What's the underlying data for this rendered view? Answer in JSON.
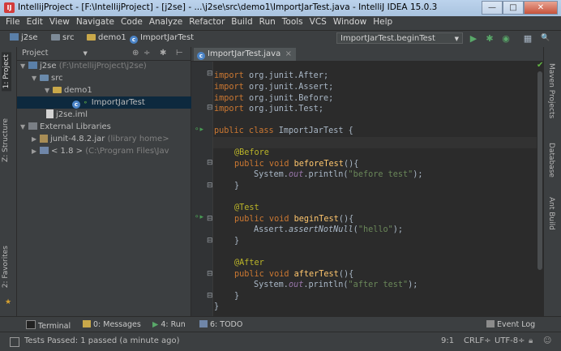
{
  "window": {
    "title": "IntellijProject - [F:\\IntellijProject] - [j2se] - ...\\j2se\\src\\demo1\\ImportJarTest.java - IntelliJ IDEA 15.0.3",
    "min": "—",
    "max": "□",
    "close": "✕"
  },
  "menu": [
    "File",
    "Edit",
    "View",
    "Navigate",
    "Code",
    "Analyze",
    "Refactor",
    "Build",
    "Run",
    "Tools",
    "VCS",
    "Window",
    "Help"
  ],
  "breadcrumb": {
    "project": "j2se",
    "src": "src",
    "pkg": "demo1",
    "file": "ImportJarTest"
  },
  "run_config": {
    "label": "ImportJarTest.beginTest",
    "caret": "▼"
  },
  "toolbar": {
    "run": "▶",
    "debug": "✱",
    "coverage": "◉",
    "structure": "▦",
    "search": "🔍"
  },
  "left_tabs": {
    "project": "1: Project",
    "structure": "Z: Structure",
    "favorites": "2: Favorites"
  },
  "right_tabs": {
    "maven": "Maven Projects",
    "database": "Database",
    "ant": "Ant Build"
  },
  "project_panel": {
    "selector": "Project",
    "caret": "▼",
    "tools": {
      "sync": "⊕",
      "collapse": "÷",
      "settings": "✱",
      "hide": "⊢"
    },
    "tree": [
      {
        "arrow": "▼",
        "label": "j2se",
        "hint": " (F:\\IntellijProject\\j2se)"
      },
      {
        "arrow": "▼",
        "label": "src",
        "hint": ""
      },
      {
        "arrow": "▼",
        "label": "demo1",
        "hint": ""
      },
      {
        "arrow": "",
        "label": "ImportJarTest",
        "hint": ""
      },
      {
        "arrow": "",
        "label": "j2se.iml",
        "hint": ""
      },
      {
        "arrow": "▼",
        "label": "External Libraries",
        "hint": ""
      },
      {
        "arrow": "▶",
        "label": "junit-4.8.2.jar",
        "hint": " (library home>"
      },
      {
        "arrow": "▶",
        "label": "< 1.8 >",
        "hint": " (C:\\Program Files\\Jav"
      }
    ]
  },
  "editor": {
    "tab_label": "ImportJarTest.java",
    "tab_close": "×",
    "ok_mark": "✔",
    "lines": {
      "l1_kw": "import",
      "l1_rest": " org.junit.After;",
      "l2_kw": "import",
      "l2_rest": " org.junit.Assert;",
      "l3_kw": "import",
      "l3_rest": " org.junit.Before;",
      "l4_kw": "import",
      "l4_rest": " org.junit.Test;",
      "l6_kw": "public class",
      "l6_rest": " ImportJarTest {",
      "l8_ann": "@Before",
      "l9_kw": "public void",
      "l9_fn": "beforeTest",
      "l9_rest": "(){",
      "l10_a": "System.",
      "l10_f": "out",
      "l10_b": ".println(",
      "l10_s": "\"before test\"",
      "l10_c": ");",
      "l11": "}",
      "l13_ann": "@Test",
      "l14_kw": "public void",
      "l14_fn": "beginTest",
      "l14_rest": "(){",
      "l15_a": "Assert.",
      "l15_m": "assertNotNull",
      "l15_b": "(",
      "l15_s": "\"hello\"",
      "l15_c": ");",
      "l16": "}",
      "l18_ann": "@After",
      "l19_kw": "public void",
      "l19_fn": "afterTest",
      "l19_rest": "(){",
      "l20_a": "System.",
      "l20_f": "out",
      "l20_b": ".println(",
      "l20_s": "\"after test\"",
      "l20_c": ");",
      "l21": "}",
      "l22": "}"
    }
  },
  "tool_windows": {
    "terminal": "Terminal",
    "messages": "0: Messages",
    "run": "4: Run",
    "todo": "6: TODO",
    "eventlog": "Event Log"
  },
  "status": {
    "message": "Tests Passed: 1 passed (a minute ago)",
    "position": "9:1",
    "line_sep": "CRLF÷",
    "encoding": "UTF-8÷"
  }
}
